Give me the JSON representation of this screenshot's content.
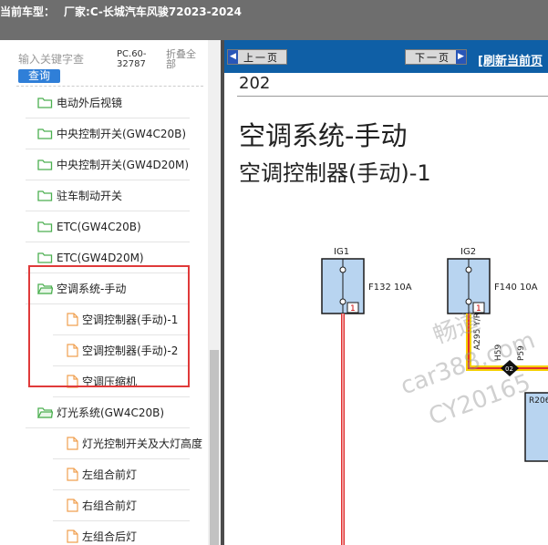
{
  "header": {
    "label": "当前车型：",
    "vehicle": "厂家:C-长城汽车风骏72023-2024"
  },
  "sidebar": {
    "search_placeholder": "输入关键字查",
    "search_button": "查询",
    "code": "PC.60-32787",
    "collapse_all": "折叠全部",
    "items": [
      {
        "label": "电动外后视镜",
        "icon": "folder-icon"
      },
      {
        "label": "中央控制开关(GW4C20B)",
        "icon": "folder-icon"
      },
      {
        "label": "中央控制开关(GW4D20M)",
        "icon": "folder-icon"
      },
      {
        "label": "驻车制动开关",
        "icon": "folder-icon"
      },
      {
        "label": "ETC(GW4C20B)",
        "icon": "folder-icon"
      },
      {
        "label": "ETC(GW4D20M)",
        "icon": "folder-icon"
      },
      {
        "label": "空调系统-手动",
        "icon": "folder-open-icon"
      },
      {
        "label": "空调控制器(手动)-1",
        "icon": "document-icon"
      },
      {
        "label": "空调控制器(手动)-2",
        "icon": "document-icon"
      },
      {
        "label": "空调压缩机",
        "icon": "document-icon"
      },
      {
        "label": "灯光系统(GW4C20B)",
        "icon": "folder-open-icon"
      },
      {
        "label": "灯光控制开关及大灯高度",
        "icon": "document-icon"
      },
      {
        "label": "左组合前灯",
        "icon": "document-icon"
      },
      {
        "label": "右组合前灯",
        "icon": "document-icon"
      },
      {
        "label": "左组合后灯",
        "icon": "document-icon"
      }
    ]
  },
  "toolbar": {
    "prev_label": "上一页",
    "next_label": "下一页",
    "refresh_label": "[刷新当前页"
  },
  "document": {
    "page_number": "202",
    "title": "空调系统-手动",
    "subtitle": "空调控制器(手动)-1",
    "diagram": {
      "fuse1_label": "IG1",
      "fuse1_text": "F132 10A",
      "fuse1_pin": "1",
      "fuse2_label": "IG2",
      "fuse2_text": "F140 10A",
      "fuse2_pin": "1",
      "wire1": "A295 Y/R",
      "wire2": "H59",
      "wire3": "P59",
      "splice": "02",
      "connector": "R206"
    },
    "watermarks": [
      "畅道",
      "car388.com",
      "CY20165"
    ]
  },
  "colors": {
    "header_bg": "#6e6e6e",
    "nav_bg": "#0f5fa6",
    "highlight": "#e03a3a",
    "search_button": "#2f7fd8",
    "folder": "#4caf50",
    "document": "#f0a050",
    "fuse_box": "#b8d4f0",
    "wire_yellow": "#f5d000",
    "wire_red": "#e03030"
  }
}
